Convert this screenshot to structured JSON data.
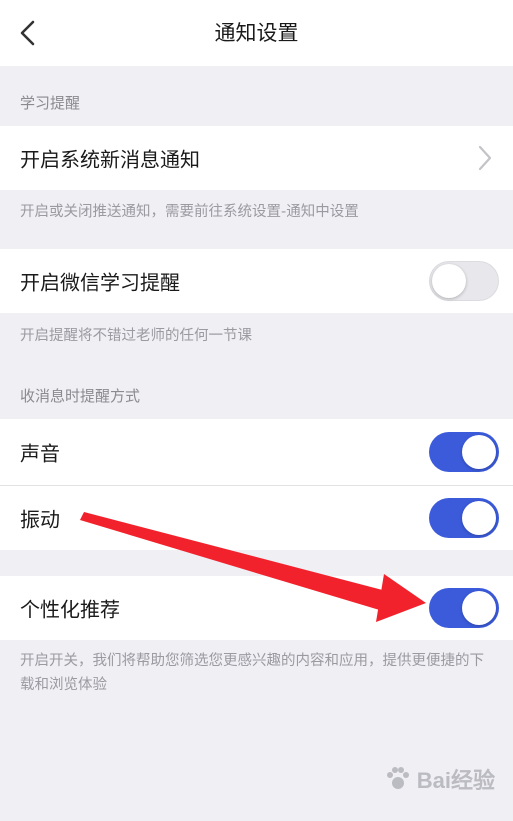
{
  "header": {
    "title": "通知设置",
    "back_icon": "chevron-left-icon"
  },
  "sections": {
    "study": {
      "label": "学习提醒"
    },
    "notify_method": {
      "label": "收消息时提醒方式"
    }
  },
  "rows": {
    "system_notify": {
      "label": "开启系统新消息通知",
      "icon": "chevron-right-icon"
    },
    "wechat_reminder": {
      "label": "开启微信学习提醒",
      "toggle_on": false
    },
    "sound": {
      "label": "声音",
      "toggle_on": true
    },
    "vibration": {
      "label": "振动",
      "toggle_on": true
    },
    "personalized": {
      "label": "个性化推荐",
      "toggle_on": true
    }
  },
  "notes": {
    "system_notify": "开启或关闭推送通知，需要前往系统设置-通知中设置",
    "wechat_reminder": "开启提醒将不错过老师的任何一节课",
    "personalized": "开启开关，我们将帮助您筛选您更感兴趣的内容和应用，提供更便捷的下载和浏览体验"
  },
  "colors": {
    "toggle_on": "#3b5bdb",
    "toggle_off": "#e8e8ec",
    "arrow": "#f2222c",
    "background": "#efeff4"
  },
  "watermark": {
    "text": "Bai经验"
  }
}
